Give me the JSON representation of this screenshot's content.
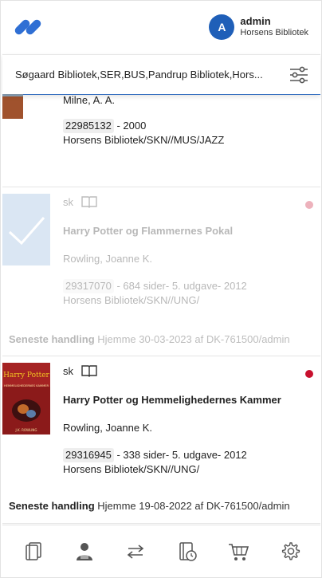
{
  "header": {
    "user_initial": "A",
    "user_name": "admin",
    "user_library": "Horsens Bibliotek"
  },
  "filter": {
    "text": "Søgaard Bibliotek,SER,BUS,Pandrup Bibliotek,Hors..."
  },
  "items": [
    {
      "author": "Milne, A. A.",
      "id": "22985132",
      "detail": " - 2000",
      "location": "Horsens Bibliotek/SKN//MUS/JAZZ"
    },
    {
      "language": "sk",
      "title": "Harry Potter og Flammernes Pokal",
      "author": "Rowling, Joanne K.",
      "id": "29317070",
      "detail": " - 684 sider- 5. udgave- 2012",
      "location": "Horsens Bibliotek/SKN//UNG/",
      "last_action_label": "Seneste handling",
      "last_action_text": " Hjemme 30-03-2023 af DK-761500/admin",
      "status_color": "#c8102e"
    },
    {
      "language": "sk",
      "title": "Harry Potter og Hemmelighedernes Kammer",
      "author": "Rowling, Joanne K.",
      "id": "29316945",
      "detail": " - 338 sider- 5. udgave- 2012",
      "location": "Horsens Bibliotek/SKN//UNG/",
      "last_action_label": "Seneste handling",
      "last_action_text": " Hjemme 19-08-2022 af DK-761500/admin",
      "status_color": "#c8102e"
    }
  ],
  "cover_text": {
    "series": "Harry Potter",
    "subtitle": "HEMMELIGHEDERNES KAMMER",
    "author": "J.K. ROWLING"
  },
  "nav": [
    "copies-icon",
    "patron-icon",
    "transfer-icon",
    "history-icon",
    "cart-icon",
    "settings-icon"
  ],
  "colors": {
    "accent": "#2f6fd4",
    "avatar": "#1f5fb8",
    "status_red": "#c8102e"
  }
}
